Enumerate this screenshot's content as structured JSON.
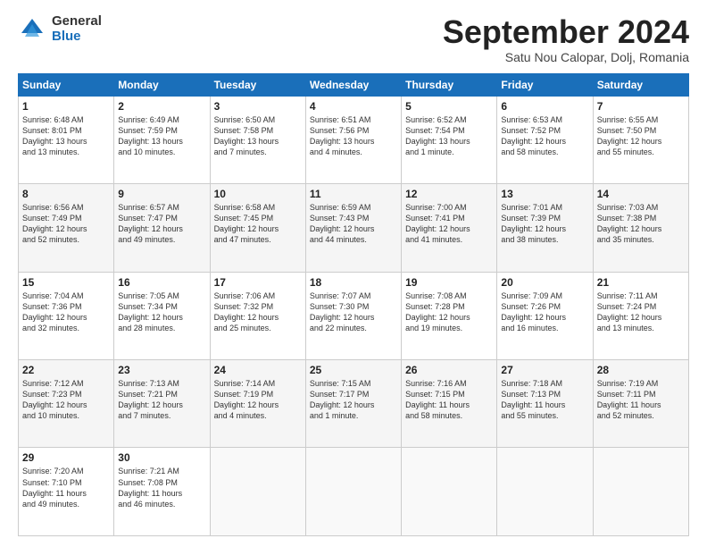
{
  "logo": {
    "general": "General",
    "blue": "Blue"
  },
  "header": {
    "month": "September 2024",
    "location": "Satu Nou Calopar, Dolj, Romania"
  },
  "weekdays": [
    "Sunday",
    "Monday",
    "Tuesday",
    "Wednesday",
    "Thursday",
    "Friday",
    "Saturday"
  ],
  "weeks": [
    [
      {
        "day": "1",
        "info": "Sunrise: 6:48 AM\nSunset: 8:01 PM\nDaylight: 13 hours\nand 13 minutes."
      },
      {
        "day": "2",
        "info": "Sunrise: 6:49 AM\nSunset: 7:59 PM\nDaylight: 13 hours\nand 10 minutes."
      },
      {
        "day": "3",
        "info": "Sunrise: 6:50 AM\nSunset: 7:58 PM\nDaylight: 13 hours\nand 7 minutes."
      },
      {
        "day": "4",
        "info": "Sunrise: 6:51 AM\nSunset: 7:56 PM\nDaylight: 13 hours\nand 4 minutes."
      },
      {
        "day": "5",
        "info": "Sunrise: 6:52 AM\nSunset: 7:54 PM\nDaylight: 13 hours\nand 1 minute."
      },
      {
        "day": "6",
        "info": "Sunrise: 6:53 AM\nSunset: 7:52 PM\nDaylight: 12 hours\nand 58 minutes."
      },
      {
        "day": "7",
        "info": "Sunrise: 6:55 AM\nSunset: 7:50 PM\nDaylight: 12 hours\nand 55 minutes."
      }
    ],
    [
      {
        "day": "8",
        "info": "Sunrise: 6:56 AM\nSunset: 7:49 PM\nDaylight: 12 hours\nand 52 minutes."
      },
      {
        "day": "9",
        "info": "Sunrise: 6:57 AM\nSunset: 7:47 PM\nDaylight: 12 hours\nand 49 minutes."
      },
      {
        "day": "10",
        "info": "Sunrise: 6:58 AM\nSunset: 7:45 PM\nDaylight: 12 hours\nand 47 minutes."
      },
      {
        "day": "11",
        "info": "Sunrise: 6:59 AM\nSunset: 7:43 PM\nDaylight: 12 hours\nand 44 minutes."
      },
      {
        "day": "12",
        "info": "Sunrise: 7:00 AM\nSunset: 7:41 PM\nDaylight: 12 hours\nand 41 minutes."
      },
      {
        "day": "13",
        "info": "Sunrise: 7:01 AM\nSunset: 7:39 PM\nDaylight: 12 hours\nand 38 minutes."
      },
      {
        "day": "14",
        "info": "Sunrise: 7:03 AM\nSunset: 7:38 PM\nDaylight: 12 hours\nand 35 minutes."
      }
    ],
    [
      {
        "day": "15",
        "info": "Sunrise: 7:04 AM\nSunset: 7:36 PM\nDaylight: 12 hours\nand 32 minutes."
      },
      {
        "day": "16",
        "info": "Sunrise: 7:05 AM\nSunset: 7:34 PM\nDaylight: 12 hours\nand 28 minutes."
      },
      {
        "day": "17",
        "info": "Sunrise: 7:06 AM\nSunset: 7:32 PM\nDaylight: 12 hours\nand 25 minutes."
      },
      {
        "day": "18",
        "info": "Sunrise: 7:07 AM\nSunset: 7:30 PM\nDaylight: 12 hours\nand 22 minutes."
      },
      {
        "day": "19",
        "info": "Sunrise: 7:08 AM\nSunset: 7:28 PM\nDaylight: 12 hours\nand 19 minutes."
      },
      {
        "day": "20",
        "info": "Sunrise: 7:09 AM\nSunset: 7:26 PM\nDaylight: 12 hours\nand 16 minutes."
      },
      {
        "day": "21",
        "info": "Sunrise: 7:11 AM\nSunset: 7:24 PM\nDaylight: 12 hours\nand 13 minutes."
      }
    ],
    [
      {
        "day": "22",
        "info": "Sunrise: 7:12 AM\nSunset: 7:23 PM\nDaylight: 12 hours\nand 10 minutes."
      },
      {
        "day": "23",
        "info": "Sunrise: 7:13 AM\nSunset: 7:21 PM\nDaylight: 12 hours\nand 7 minutes."
      },
      {
        "day": "24",
        "info": "Sunrise: 7:14 AM\nSunset: 7:19 PM\nDaylight: 12 hours\nand 4 minutes."
      },
      {
        "day": "25",
        "info": "Sunrise: 7:15 AM\nSunset: 7:17 PM\nDaylight: 12 hours\nand 1 minute."
      },
      {
        "day": "26",
        "info": "Sunrise: 7:16 AM\nSunset: 7:15 PM\nDaylight: 11 hours\nand 58 minutes."
      },
      {
        "day": "27",
        "info": "Sunrise: 7:18 AM\nSunset: 7:13 PM\nDaylight: 11 hours\nand 55 minutes."
      },
      {
        "day": "28",
        "info": "Sunrise: 7:19 AM\nSunset: 7:11 PM\nDaylight: 11 hours\nand 52 minutes."
      }
    ],
    [
      {
        "day": "29",
        "info": "Sunrise: 7:20 AM\nSunset: 7:10 PM\nDaylight: 11 hours\nand 49 minutes."
      },
      {
        "day": "30",
        "info": "Sunrise: 7:21 AM\nSunset: 7:08 PM\nDaylight: 11 hours\nand 46 minutes."
      },
      {
        "day": "",
        "info": ""
      },
      {
        "day": "",
        "info": ""
      },
      {
        "day": "",
        "info": ""
      },
      {
        "day": "",
        "info": ""
      },
      {
        "day": "",
        "info": ""
      }
    ]
  ]
}
